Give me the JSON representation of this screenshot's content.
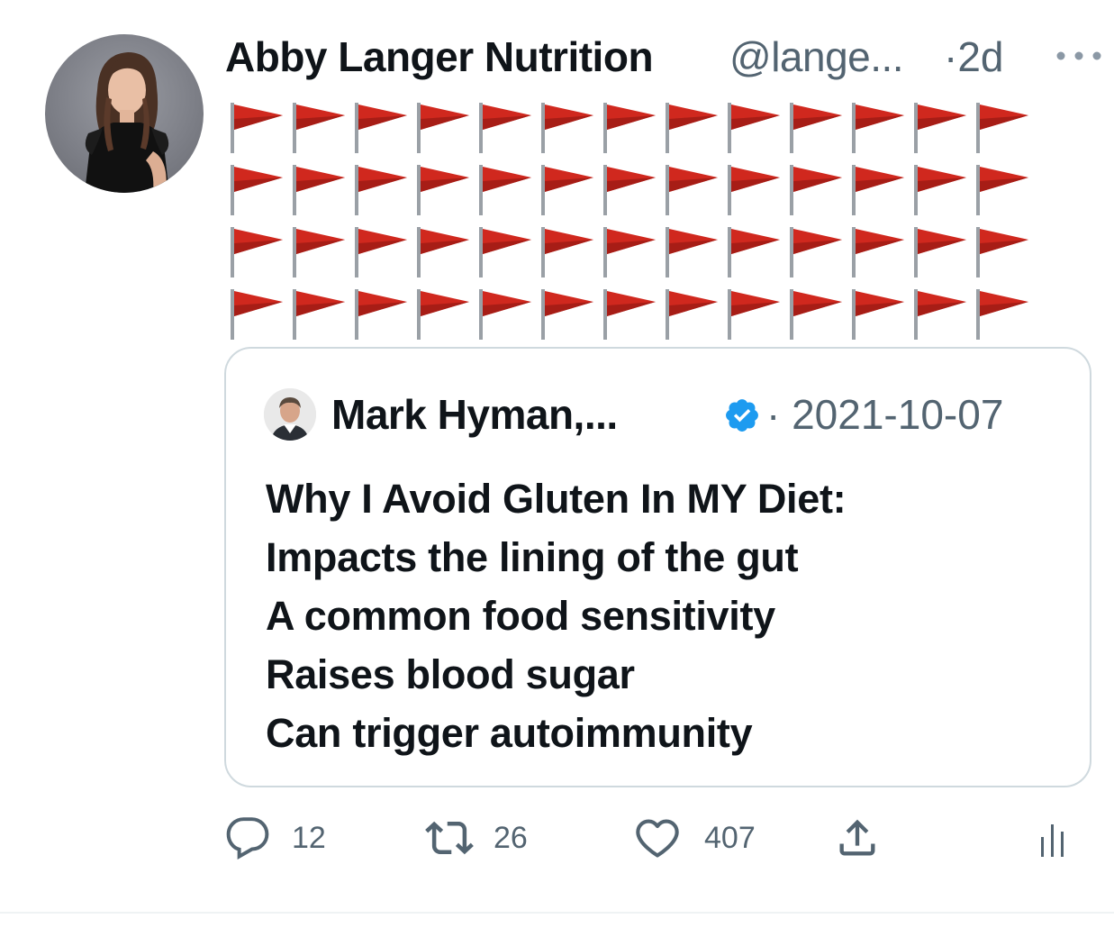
{
  "tweet": {
    "author_name": "Abby Langer Nutrition",
    "author_handle": "@lange...",
    "time_sep": "·",
    "time": "2d",
    "flag_rows": 4,
    "flags_per_row": 13,
    "flag_emoji_name": "triangular-flag-icon",
    "flag_color": "#d0281e"
  },
  "quoted_tweet": {
    "author_name": "Mark Hyman,...",
    "verified": true,
    "verified_color": "#1d9bf0",
    "date": "· 2021-10-07",
    "lines": [
      "Why I Avoid Gluten In MY Diet:",
      "Impacts the lining of the gut",
      "A common food sensitivity",
      "Raises blood sugar",
      "Can trigger autoimmunity"
    ]
  },
  "actions": {
    "reply_count": "12",
    "retweet_count": "26",
    "like_count": "407",
    "icons": [
      "reply-icon",
      "retweet-icon",
      "like-icon",
      "share-icon",
      "analytics-icon"
    ],
    "icon_color": "#536471"
  }
}
